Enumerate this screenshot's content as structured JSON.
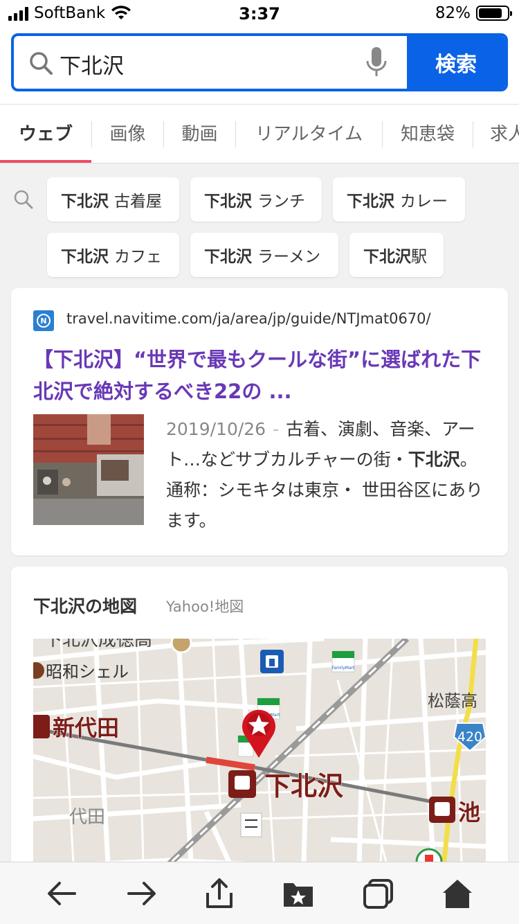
{
  "status": {
    "carrier": "SoftBank",
    "time": "3:37",
    "battery": "82%",
    "battery_level": 0.82
  },
  "search": {
    "query": "下北沢",
    "button_label": "検索"
  },
  "tabs": [
    {
      "label": "ウェブ",
      "active": true
    },
    {
      "label": "画像"
    },
    {
      "label": "動画"
    },
    {
      "label": "リアルタイム"
    },
    {
      "label": "知恵袋"
    },
    {
      "label": "求人"
    }
  ],
  "suggestions": [
    {
      "bold": "下北沢",
      "rest": "古着屋"
    },
    {
      "bold": "下北沢",
      "rest": "ランチ"
    },
    {
      "bold": "下北沢",
      "rest": "カレー"
    },
    {
      "bold": "下北沢",
      "rest": "カフェ"
    },
    {
      "bold": "下北沢",
      "rest": "ラーメン"
    },
    {
      "bold": "下北沢",
      "rest": "駅"
    }
  ],
  "result": {
    "url": "travel.navitime.com/ja/area/jp/guide/NTJmat0670/",
    "title": "【下北沢】“世界で最もクールな街”に選ばれた下北沢で絶対するべき22の ...",
    "date": "2019/10/26",
    "snippet_pre": "古着、演劇、音楽、アート…などサブカルチャーの街・",
    "snippet_bold": "下北沢",
    "snippet_post": "。通称：シモキタは東京・ 世田谷区にあります。"
  },
  "map": {
    "title": "下北沢の地図",
    "source": "Yahoo!地図",
    "labels": {
      "school_top": "下北沢成徳高",
      "showa_shell": "昭和シェル",
      "shindaita": "新代田",
      "shimokitazawa": "下北沢",
      "daita": "代田",
      "shoin": "松蔭高",
      "ike": "池",
      "route": "420",
      "familymart": "FamilyMart"
    }
  },
  "bottom_nav": [
    "back-icon",
    "forward-icon",
    "share-icon",
    "bookmark-icon",
    "tabs-icon",
    "home-icon"
  ]
}
